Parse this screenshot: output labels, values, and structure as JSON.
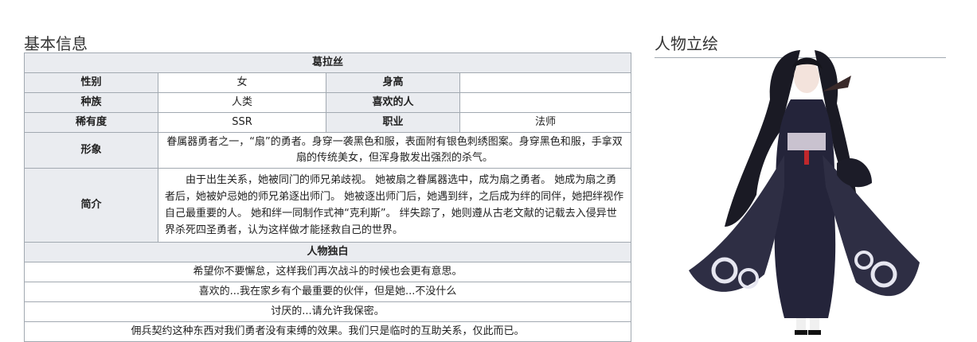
{
  "section_basic": "基本信息",
  "section_portrait": "人物立绘",
  "character": {
    "name": "葛拉丝",
    "gender_label": "性别",
    "gender_value": "女",
    "height_label": "身高",
    "height_value": "",
    "race_label": "种族",
    "race_value": "人类",
    "likes_label": "喜欢的人",
    "likes_value": "",
    "rarity_label": "稀有度",
    "rarity_value": "SSR",
    "class_label": "职业",
    "class_value": "法师",
    "image_label": "形象",
    "image_value": "眷属器勇者之一，“扇”的勇者。身穿一袭黑色和服，表面附有银色刺绣图案。身穿黑色和服，手拿双扇的传统美女，但浑身散发出强烈的杀气。",
    "intro_label": "简介",
    "intro_value": "由于出生关系，她被同门的师兄弟歧视。 她被扇之眷属器选中，成为扇之勇者。 她成为扇之勇者后，她被妒忌她的师兄弟逐出师门。 她被逐出师门后，她遇到绊，之后成为绊的同伴，她把绊视作自己最重要的人。 她和绊一同制作式神“克利斯”。 绊失踪了，她则遵从古老文献的记载去入侵异世界杀死四圣勇者，认为这样做才能拯救自己的世界。"
  },
  "monologue": {
    "header": "人物独白",
    "lines": [
      "希望你不要懈怠，这样我们再次战斗的时候也会更有意思。",
      "喜欢的...我在家乡有个最重要的伙伴，但是她...不没什么",
      "讨厌的...请允许我保密。",
      "佣兵契约这种东西对我们勇者没有束缚的效果。我们只是临时的互助关系，仅此而已。"
    ]
  }
}
